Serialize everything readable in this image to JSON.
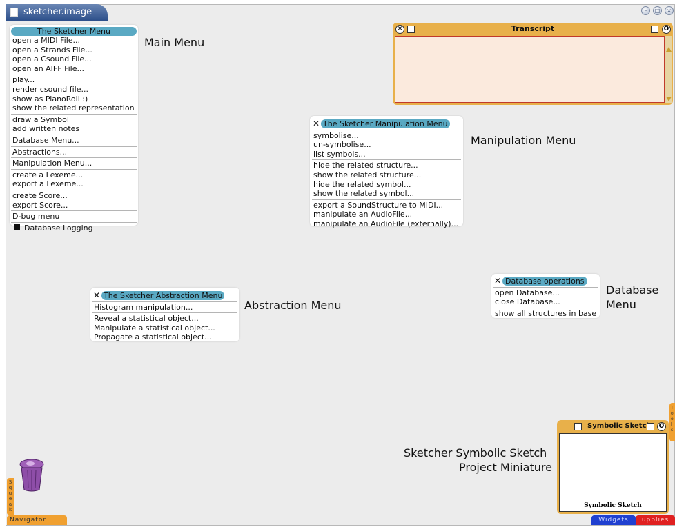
{
  "window": {
    "title": "sketcher.image"
  },
  "main_menu": {
    "title": "The Sketcher Menu",
    "groups": [
      [
        "open a MIDI File...",
        "open a Strands File...",
        "open a Csound File...",
        "open an AIFF File..."
      ],
      [
        "play...",
        "render csound file...",
        "show as PianoRoll :)",
        "show the related representation"
      ],
      [
        "draw a Symbol",
        "add written notes"
      ],
      [
        "Database Menu..."
      ],
      [
        "Abstractions..."
      ],
      [
        "Manipulation Menu..."
      ],
      [
        "create a Lexeme...",
        "export a Lexeme..."
      ],
      [
        "create Score...",
        "export Score..."
      ],
      [
        "D-bug menu"
      ]
    ],
    "checkbox_label": "Database Logging"
  },
  "manipulation_menu": {
    "title": "The Sketcher Manipulation Menu",
    "groups": [
      [
        "symbolise...",
        "un-symbolise...",
        "list symbols..."
      ],
      [
        "hide the related structure...",
        "show the related structure...",
        "hide the related symbol...",
        "show the related symbol..."
      ],
      [
        "export a SoundStructure to MIDI...",
        "manipulate an AudioFile...",
        "manipulate an AudioFile (externally)..."
      ]
    ]
  },
  "abstraction_menu": {
    "title": "The Sketcher Abstraction Menu",
    "groups": [
      [
        "Histogram manipulation..."
      ],
      [
        "Reveal a statistical object...",
        "Manipulate a statistical object...",
        "Propagate a statistical object..."
      ]
    ]
  },
  "database_menu": {
    "title": "Database operations",
    "groups": [
      [
        "open Database...",
        "close Database..."
      ],
      [
        "show all structures in base"
      ]
    ]
  },
  "labels": {
    "main_menu": "Main Menu",
    "manipulation_menu": "Manipulation Menu",
    "abstraction_menu": "Abstraction Menu",
    "database_menu_line1": "Database",
    "database_menu_line2": "Menu",
    "miniature_line1": "Sketcher Symbolic Sketch",
    "miniature_line2": "Project Miniature"
  },
  "transcript": {
    "title": "Transcript"
  },
  "miniature": {
    "title": "Symbolic Sketch",
    "caption": "Symbolic Sketch"
  },
  "flaps": {
    "navigator": "Navigator",
    "squeak": "Squeak",
    "widgets": "Widgets",
    "supplies": "upplies",
    "tools": "Tools"
  },
  "icons": {
    "trash": "trash-icon",
    "close": "close-icon",
    "window_menu": "window-menu-icon"
  },
  "colors": {
    "menu_title": "#5aa9c3",
    "transcript_frame": "#e8b04a",
    "title_tab": "#2c4f8a",
    "flap_orange": "#f0a030",
    "flap_blue": "#2040d0",
    "flap_red": "#e02020"
  }
}
